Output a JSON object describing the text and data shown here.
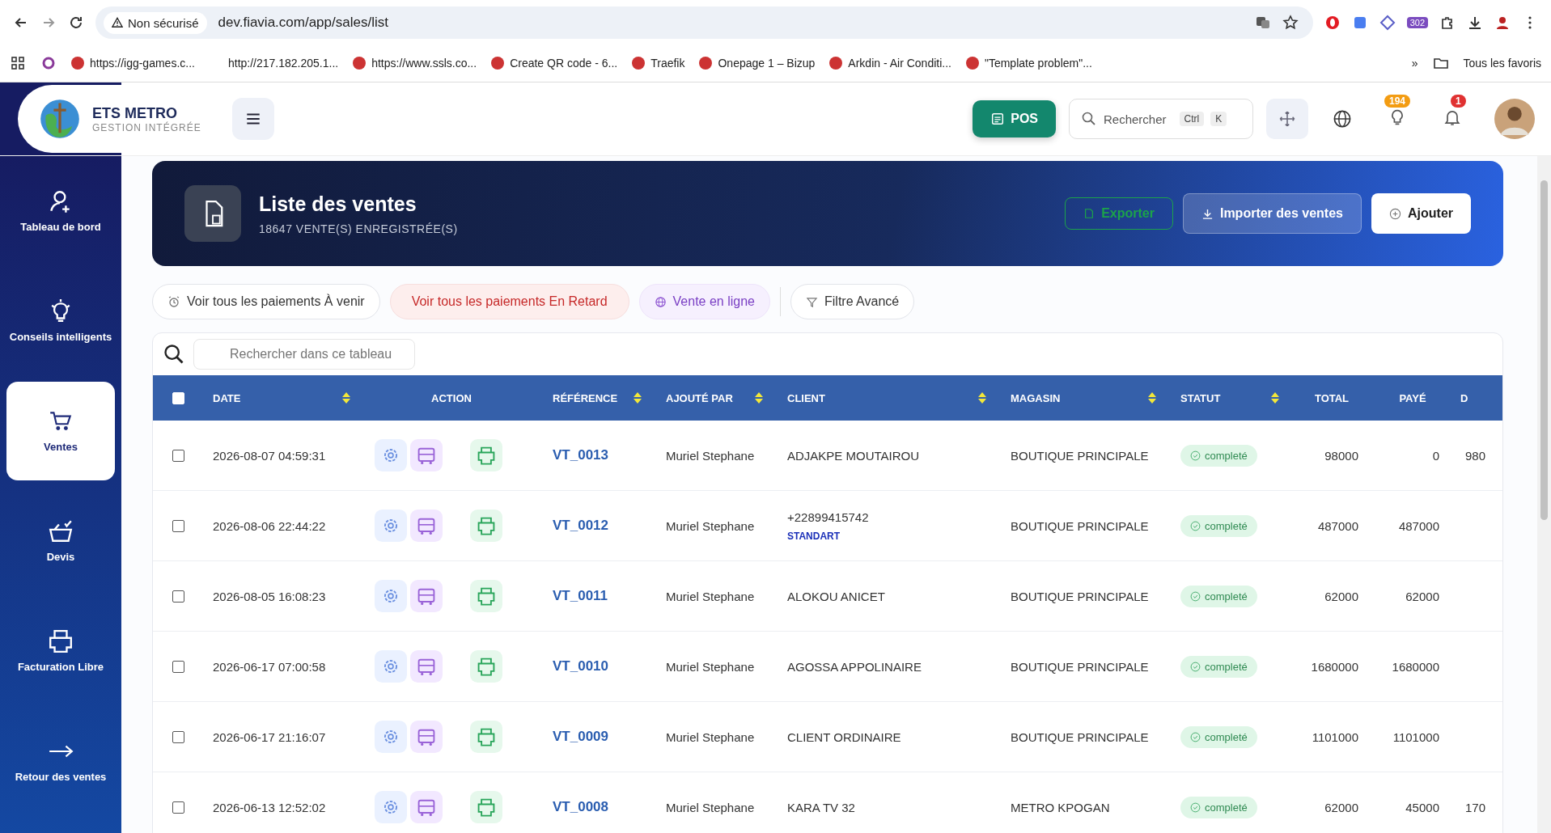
{
  "browser": {
    "security": "Non sécurisé",
    "url": "dev.fiavia.com/app/sales/list",
    "extension_badge": "302",
    "bookmarks": [
      {
        "label": "https://igg-games.c..."
      },
      {
        "label": "http://217.182.205.1..."
      },
      {
        "label": "https://www.ssls.co..."
      },
      {
        "label": "Create QR code - 6..."
      },
      {
        "label": "Traefik"
      },
      {
        "label": "Onepage 1 – Bizup"
      },
      {
        "label": "Arkdin - Air Conditi..."
      },
      {
        "label": "\"Template problem\"..."
      }
    ],
    "more": "»",
    "all_bookmarks": "Tous les favoris"
  },
  "brand": {
    "name": "ETS METRO",
    "tagline": "GESTION INTÉGRÉE"
  },
  "header": {
    "pos": "POS",
    "search": "Rechercher",
    "keys": [
      "Ctrl",
      "K"
    ],
    "tips_badge": "194",
    "notif_badge": "1"
  },
  "sidebar": {
    "items": [
      {
        "label": "Tableau de bord",
        "selected": false
      },
      {
        "label": "Conseils intelligents",
        "selected": false
      },
      {
        "label": "Ventes",
        "selected": true
      },
      {
        "label": "Devis",
        "selected": false
      },
      {
        "label": "Facturation Libre",
        "selected": false
      },
      {
        "label": "Retour des ventes",
        "selected": false
      }
    ]
  },
  "banner": {
    "title": "Liste des ventes",
    "subtitle": "18647 VENTE(S) ENREGISTRÉE(S)",
    "buttons": [
      {
        "label": "Exporter",
        "kind": "export"
      },
      {
        "label": "Importer des ventes",
        "kind": "import"
      },
      {
        "label": "Ajouter",
        "kind": "add"
      }
    ]
  },
  "filters": [
    {
      "label": "Voir tous les paiements À venir",
      "kind": "upcoming"
    },
    {
      "label": "Voir tous les paiements En Retard",
      "kind": "late"
    },
    {
      "label": "Vente en ligne",
      "kind": "online"
    },
    {
      "label": "Filtre Avancé",
      "kind": "advanced"
    }
  ],
  "table": {
    "search_placeholder": "Rechercher dans ce tableau",
    "select_all": false,
    "columns": [
      {
        "label": "DATE",
        "sortable": true
      },
      {
        "label": "ACTION",
        "sortable": false
      },
      {
        "label": "RÉFÉRENCE",
        "sortable": true
      },
      {
        "label": "AJOUTÉ PAR",
        "sortable": true
      },
      {
        "label": "CLIENT",
        "sortable": true
      },
      {
        "label": "MAGASIN",
        "sortable": true
      },
      {
        "label": "STATUT",
        "sortable": true
      },
      {
        "label": "TOTAL",
        "sortable": false
      },
      {
        "label": "PAYÉ",
        "sortable": false
      },
      {
        "label": "D",
        "sortable": false
      }
    ],
    "rows": [
      {
        "checked": false,
        "date": "2026-08-07 04:59:31",
        "reference": "VT_0013",
        "added_by": "Muriel Stephane",
        "client": "ADJAKPE MOUTAIROU",
        "store": "BOUTIQUE PRINCIPALE",
        "status": "completé",
        "total": "98000",
        "paid": "0",
        "due": "980"
      },
      {
        "checked": false,
        "date": "2026-08-06 22:44:22",
        "reference": "VT_0012",
        "added_by": "Muriel Stephane",
        "client": "+22899415742",
        "client_tag": "STANDART",
        "store": "BOUTIQUE PRINCIPALE",
        "status": "completé",
        "total": "487000",
        "paid": "487000"
      },
      {
        "checked": false,
        "date": "2026-08-05 16:08:23",
        "reference": "VT_0011",
        "added_by": "Muriel Stephane",
        "client": "ALOKOU ANICET",
        "store": "BOUTIQUE PRINCIPALE",
        "status": "completé",
        "total": "62000",
        "paid": "62000"
      },
      {
        "checked": false,
        "date": "2026-06-17 07:00:58",
        "reference": "VT_0010",
        "added_by": "Muriel Stephane",
        "client": "AGOSSA APPOLINAIRE",
        "store": "BOUTIQUE PRINCIPALE",
        "status": "completé",
        "total": "1680000",
        "paid": "1680000"
      },
      {
        "checked": false,
        "date": "2026-06-17 21:16:07",
        "reference": "VT_0009",
        "added_by": "Muriel Stephane",
        "client": "CLIENT ORDINAIRE",
        "store": "BOUTIQUE PRINCIPALE",
        "status": "completé",
        "total": "1101000",
        "paid": "1101000"
      },
      {
        "checked": false,
        "date": "2026-06-13 12:52:02",
        "reference": "VT_0008",
        "added_by": "Muriel Stephane",
        "client": "KARA TV 32",
        "store": "METRO KPOGAN",
        "status": "completé",
        "total": "62000",
        "paid": "45000",
        "due": "170"
      }
    ]
  }
}
